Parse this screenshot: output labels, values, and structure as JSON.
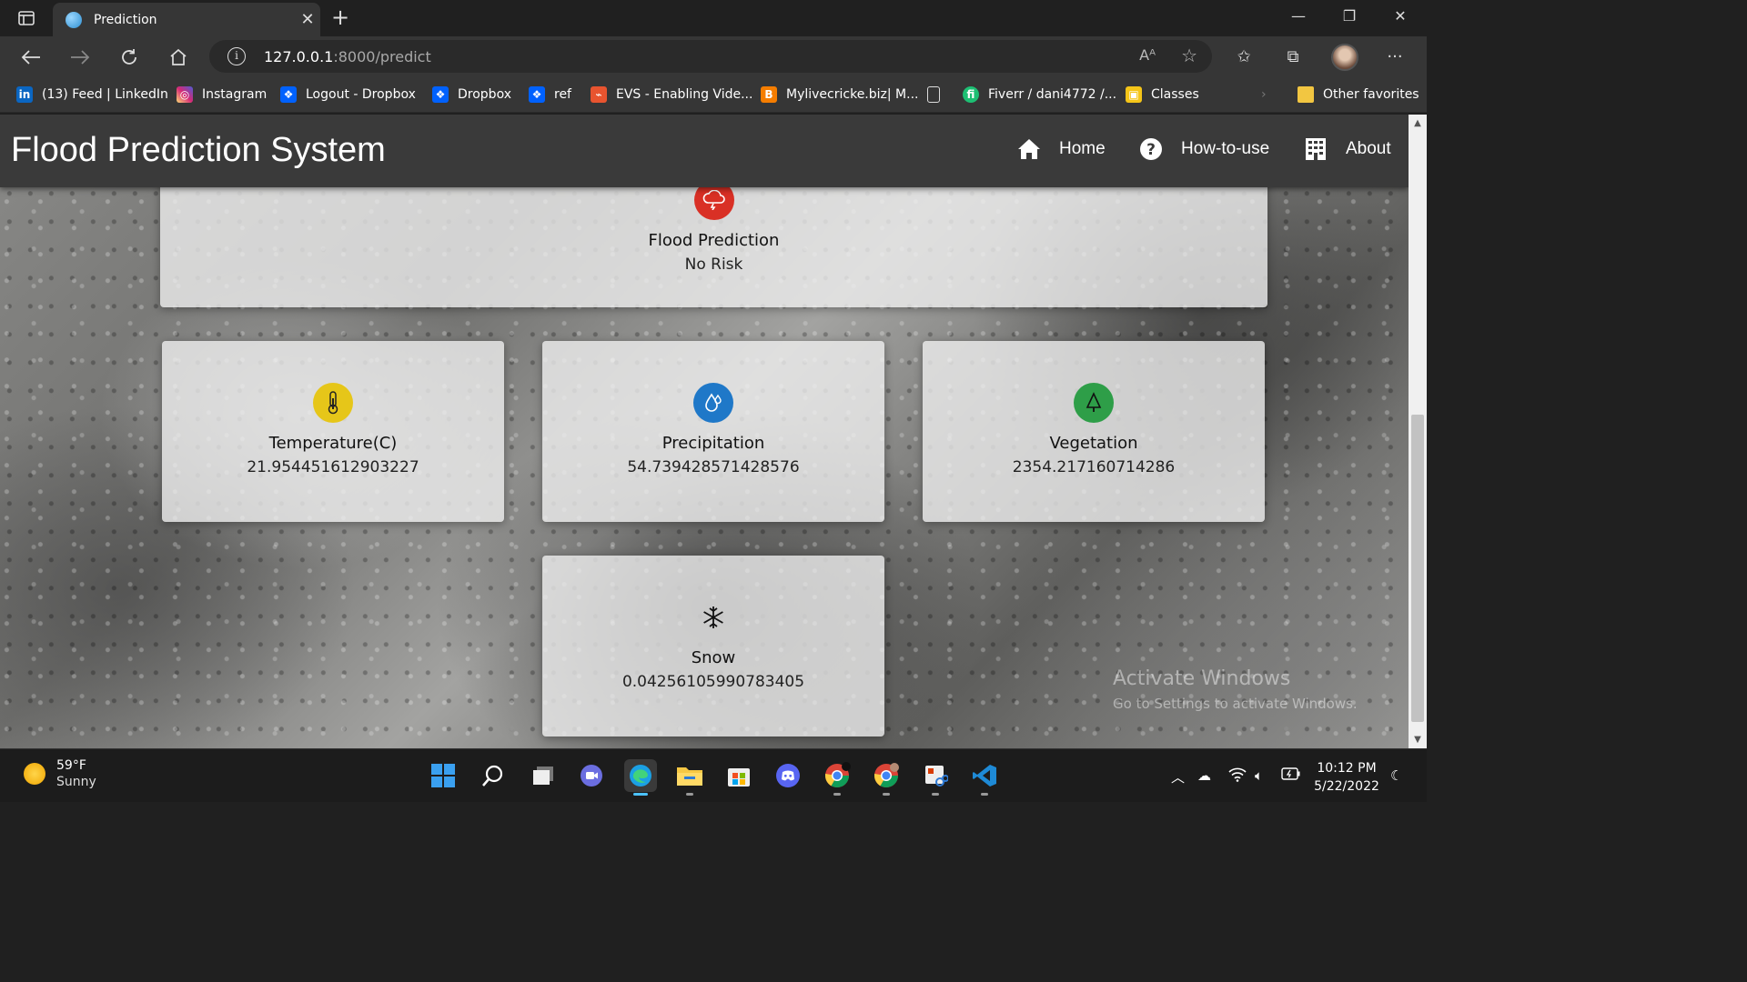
{
  "browser": {
    "tab_title": "Prediction",
    "url_host": "127.0.0.1",
    "url_path": ":8000/predict",
    "read_aloud": "Aᴬ",
    "bookmarks": [
      {
        "label": "(13) Feed | LinkedIn",
        "color": "#0a66c2",
        "glyph": "in"
      },
      {
        "label": "Instagram",
        "color": "#d62976",
        "glyph": "◎"
      },
      {
        "label": "Logout - Dropbox",
        "color": "#0061fe",
        "glyph": "❖"
      },
      {
        "label": "Dropbox",
        "color": "#0061fe",
        "glyph": "❖"
      },
      {
        "label": "ref",
        "color": "#0061fe",
        "glyph": "❖"
      },
      {
        "label": "EVS - Enabling Vide...",
        "color": "#e8542f",
        "glyph": "⌁"
      },
      {
        "label": "Mylivecricke.biz| M...",
        "color": "#f57d00",
        "glyph": "B"
      },
      {
        "label": "",
        "color": "transparent",
        "glyph": "☐"
      },
      {
        "label": "Fiverr / dani4772 /...",
        "color": "#1dbf73",
        "glyph": "fi"
      },
      {
        "label": "Classes",
        "color": "#f5c518",
        "glyph": "▣"
      }
    ],
    "other_favorites": "Other favorites"
  },
  "navbar": {
    "brand": "Flood Prediction System",
    "links": [
      {
        "label": "Home",
        "icon": "home-icon"
      },
      {
        "label": "How-to-use",
        "icon": "question-icon"
      },
      {
        "label": "About",
        "icon": "building-icon"
      }
    ]
  },
  "prediction": {
    "title": "Flood Prediction",
    "value": "No Risk",
    "icon_color": "#d93025"
  },
  "cards": [
    {
      "title": "Temperature(C)",
      "value": "21.954451612903227",
      "icon": "thermometer-icon",
      "color": "#e6c619"
    },
    {
      "title": "Precipitation",
      "value": "54.739428571428576",
      "icon": "water-drop-icon",
      "color": "#1f78c8"
    },
    {
      "title": "Vegetation",
      "value": "2354.217160714286",
      "icon": "tree-icon",
      "color": "#2e9e48"
    },
    {
      "title": "Snow",
      "value": "0.04256105990783405",
      "icon": "snowflake-icon",
      "color": "transparent"
    }
  ],
  "watermark": {
    "line1": "Activate Windows",
    "line2": "Go to Settings to activate Windows."
  },
  "taskbar": {
    "temp": "59°F",
    "condition": "Sunny",
    "time": "10:12 PM",
    "date": "5/22/2022"
  }
}
